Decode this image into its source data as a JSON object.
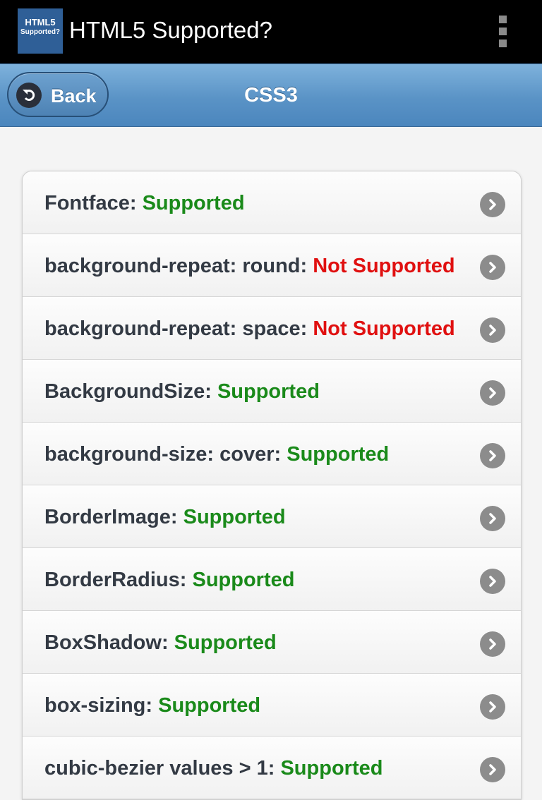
{
  "app": {
    "icon_line1": "HTML5",
    "icon_line2": "Supported?",
    "title": "HTML5 Supported?"
  },
  "header": {
    "back_label": "Back",
    "title": "CSS3"
  },
  "colors": {
    "supported": "#1a8a1a",
    "not_supported": "#e01010",
    "header_blue": "#5a93c6"
  },
  "features": [
    {
      "name": "Fontface: ",
      "status": "Supported",
      "supported": true
    },
    {
      "name": "background-repeat: round: ",
      "status": "Not Supported",
      "supported": false
    },
    {
      "name": "background-repeat: space: ",
      "status": "Not Supported",
      "supported": false
    },
    {
      "name": "BackgroundSize: ",
      "status": "Supported",
      "supported": true
    },
    {
      "name": "background-size: cover: ",
      "status": "Supported",
      "supported": true
    },
    {
      "name": "BorderImage: ",
      "status": "Supported",
      "supported": true
    },
    {
      "name": "BorderRadius: ",
      "status": "Supported",
      "supported": true
    },
    {
      "name": "BoxShadow: ",
      "status": "Supported",
      "supported": true
    },
    {
      "name": "box-sizing: ",
      "status": "Supported",
      "supported": true
    },
    {
      "name": "cubic-bezier values > 1: ",
      "status": "Supported",
      "supported": true
    }
  ]
}
